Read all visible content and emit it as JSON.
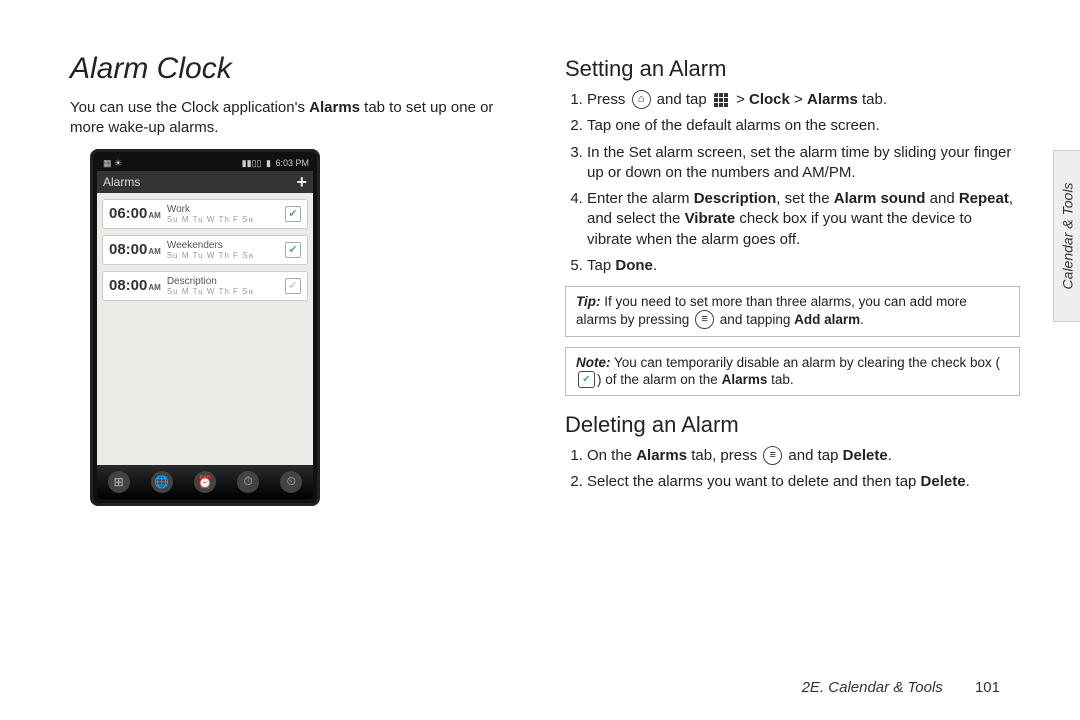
{
  "left": {
    "title": "Alarm Clock",
    "intro_a": "You can use the Clock application's ",
    "intro_bold": "Alarms",
    "intro_b": " tab to set up one or more wake-up alarms."
  },
  "phone": {
    "time": "6:03 PM",
    "tab_label": "Alarms",
    "alarms": [
      {
        "time": "06:00",
        "ampm": "AM",
        "label": "Work",
        "days": "Su M Tu W Th F Sa",
        "checked": true
      },
      {
        "time": "08:00",
        "ampm": "AM",
        "label": "Weekenders",
        "days": "Su M Tu W Th F Sa",
        "checked": true
      },
      {
        "time": "08:00",
        "ampm": "AM",
        "label": "Description",
        "days": "Su M Tu W Th F Sa",
        "checked": false
      }
    ]
  },
  "right": {
    "h_setting": "Setting an Alarm",
    "step1_a": "Press ",
    "step1_b": " and tap ",
    "step1_c": " > ",
    "step1_bold1": "Clock",
    "step1_d": " > ",
    "step1_bold2": "Alarms",
    "step1_e": " tab.",
    "step2": "Tap one of the default alarms on the screen.",
    "step3": "In the Set alarm screen, set the alarm time by sliding your finger up or down on the numbers and AM/PM.",
    "step4_a": "Enter the alarm ",
    "step4_b1": "Description",
    "step4_b": ", set the ",
    "step4_b2": "Alarm sound",
    "step4_c": " and ",
    "step4_b3": "Repeat",
    "step4_d": ", and select the ",
    "step4_b4": "Vibrate",
    "step4_e": " check box if you want the device to vibrate when the alarm goes off.",
    "step5_a": "Tap ",
    "step5_b": "Done",
    "step5_c": ".",
    "tip_lead": "Tip:",
    "tip_a": "If you need to set more than three alarms, you can add more alarms by pressing ",
    "tip_b": " and tapping ",
    "tip_bold": "Add alarm",
    "tip_c": ".",
    "note_lead": "Note:",
    "note_a": "You can temporarily disable an alarm by clearing the check box (",
    "note_b": ") of the alarm on the ",
    "note_bold": "Alarms",
    "note_c": " tab.",
    "h_deleting": "Deleting an Alarm",
    "d_step1_a": "On the ",
    "d_step1_bold1": "Alarms",
    "d_step1_b": " tab, press ",
    "d_step1_c": " and tap ",
    "d_step1_bold2": "Delete",
    "d_step1_d": ".",
    "d_step2_a": "Select the alarms you want to delete and then tap ",
    "d_step2_bold": "Delete",
    "d_step2_b": "."
  },
  "sidetab": "Calendar & Tools",
  "footer_section": "2E. Calendar & Tools",
  "footer_page": "101"
}
